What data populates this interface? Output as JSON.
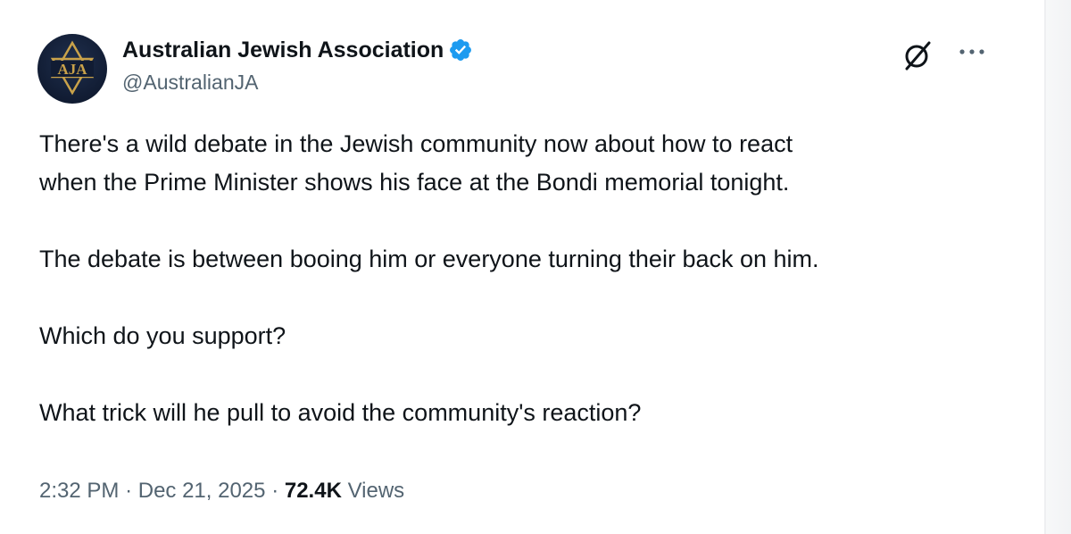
{
  "author": {
    "display_name": "Australian Jewish Association",
    "handle": "@AustralianJA",
    "avatar_text": "AJA",
    "verified": true,
    "verified_color": "#1d9bf0"
  },
  "actions": {
    "grok_icon": "grok-icon",
    "more_icon": "more-icon"
  },
  "tweet": {
    "paragraphs": [
      "There's a wild debate in the Jewish community now about how to react",
      "when the Prime Minister shows his face at the Bondi memorial tonight.",
      "The debate is between booing him or everyone turning their back on him.",
      "Which do you support?",
      "What trick will he pull to avoid the community's reaction?"
    ]
  },
  "meta": {
    "time": "2:32 PM",
    "separator": "·",
    "date": "Dec 21, 2025",
    "views_count": "72.4K",
    "views_label": "Views"
  },
  "colors": {
    "text_primary": "#0f1419",
    "text_secondary": "#536471",
    "avatar_bg": "#111c33",
    "avatar_gold": "#c9a24a"
  }
}
